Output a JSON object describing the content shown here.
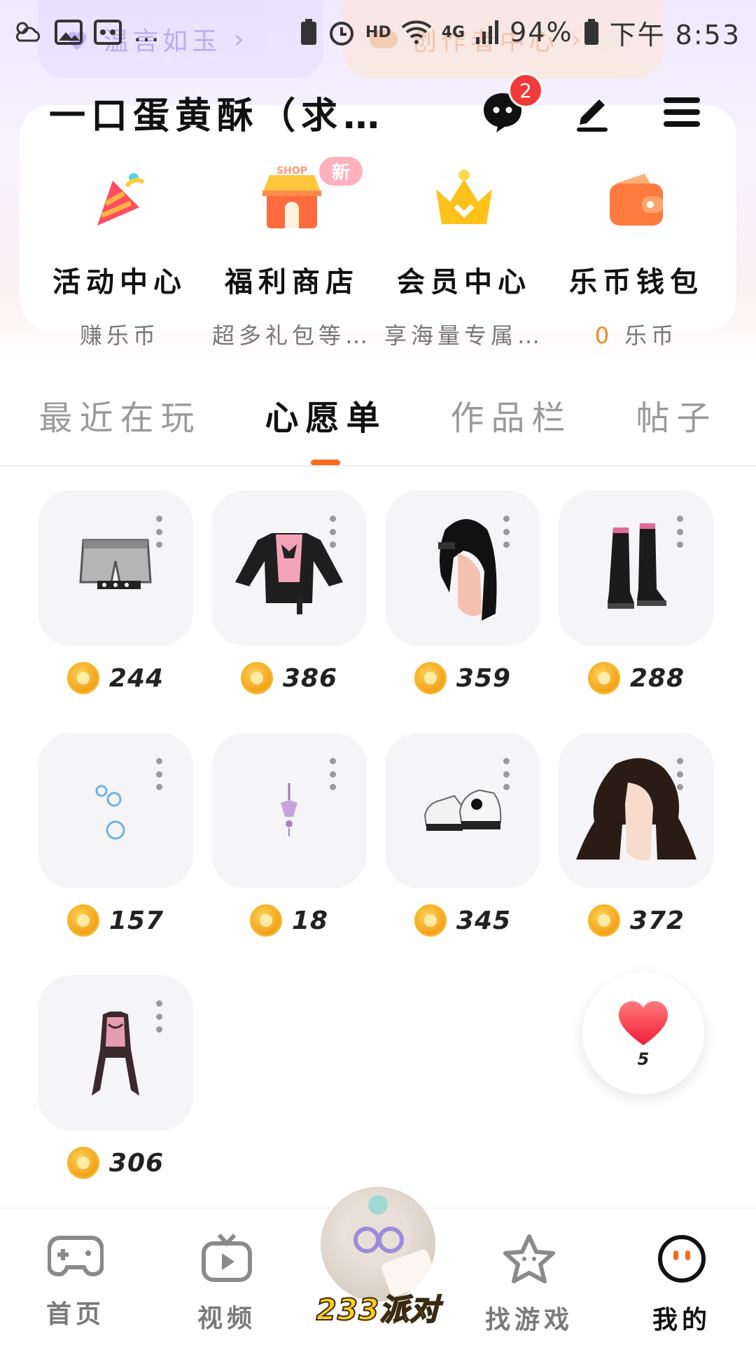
{
  "background_chips": {
    "left_label": "温言如玉",
    "right_label": "创作者中心"
  },
  "status_bar": {
    "overflow": "…",
    "hd": "HD",
    "network": "4G",
    "battery": "94%",
    "time": "下午 8:53"
  },
  "profile": {
    "username": "一口蛋黄酥（求…",
    "message_badge": "2"
  },
  "quick_entries": [
    {
      "title": "活动中心",
      "subtitle": "赚乐币",
      "icon": "party-popper-icon"
    },
    {
      "title": "福利商店",
      "subtitle": "超多礼包等…",
      "icon": "shop-icon",
      "badge": "新",
      "shop_text": "SHOP"
    },
    {
      "title": "会员中心",
      "subtitle": "享海量专属…",
      "icon": "crown-icon"
    },
    {
      "title": "乐币钱包",
      "subtitle_value": "0",
      "subtitle": "乐币",
      "icon": "wallet-icon"
    }
  ],
  "tabs": [
    {
      "label": "最近在玩",
      "active": false
    },
    {
      "label": "心愿单",
      "active": true
    },
    {
      "label": "作品栏",
      "active": false
    },
    {
      "label": "帖子",
      "active": false
    }
  ],
  "wishlist": [
    {
      "item": "shorts",
      "price": "244"
    },
    {
      "item": "leather-jacket",
      "price": "386"
    },
    {
      "item": "hair-long-black",
      "price": "359"
    },
    {
      "item": "boots",
      "price": "288"
    },
    {
      "item": "bubbles",
      "price": "157"
    },
    {
      "item": "earring",
      "price": "18"
    },
    {
      "item": "sneakers",
      "price": "345"
    },
    {
      "item": "hair-wavy-brown",
      "price": "372"
    },
    {
      "item": "lace-top",
      "price": "306"
    }
  ],
  "like_button": {
    "count": "5"
  },
  "bottom_nav": [
    {
      "label": "首页",
      "icon": "gamepad-icon",
      "active": false
    },
    {
      "label": "视频",
      "icon": "tv-icon",
      "active": false
    },
    {
      "label": "233派对",
      "icon": "party-avatar",
      "active": false
    },
    {
      "label": "找游戏",
      "icon": "star-icon",
      "active": false
    },
    {
      "label": "我的",
      "icon": "face-icon",
      "active": true
    }
  ],
  "colors": {
    "accent": "#ff6a1c",
    "badge": "#f23a3a",
    "coin": "#f2a21a"
  }
}
